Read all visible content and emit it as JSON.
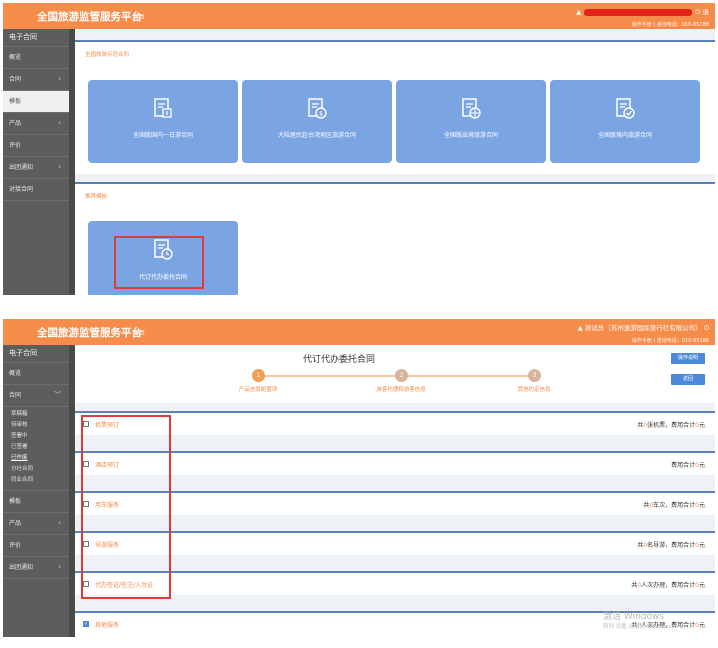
{
  "shot1": {
    "brand": "全国旅游监管服务平台",
    "home": "首页",
    "user_tail": "退",
    "user_sub": "操作手册 | 咨询电话：010-65788",
    "sidebar": [
      {
        "label": "电子合同",
        "type": "header"
      },
      {
        "label": "概览",
        "chev": ""
      },
      {
        "label": "合同",
        "chev": "‹"
      },
      {
        "label": "模板",
        "chev": "",
        "active": true
      },
      {
        "label": "产品",
        "chev": "‹"
      },
      {
        "label": "评价",
        "chev": ""
      },
      {
        "label": "出团通知",
        "chev": "‹"
      },
      {
        "label": "对接合同",
        "chev": ""
      }
    ],
    "panel1_title": "全国旅游示范合同",
    "cards": [
      {
        "label": "全国版国内一日游合同"
      },
      {
        "label": "大陆居民赴台湾地区旅游合同"
      },
      {
        "label": "全国版出境旅游合同"
      },
      {
        "label": "全国版境内旅游合同"
      }
    ],
    "panel2_title": "推荐模板",
    "recommend_card": "代订代办委托合同"
  },
  "shot2": {
    "brand": "全国旅游监管服务平台",
    "home": "首页",
    "user": "测试员（苏州速游国际旅行社有限公司）",
    "user_sub": "操作手册 | 咨询电话：010-65188",
    "sidebar_header": "电子合同",
    "sidebar_top": [
      {
        "label": "概览",
        "chev": ""
      },
      {
        "label": "合同",
        "chev": "﹀"
      }
    ],
    "sidebar_sub": [
      "草稿箱",
      "待审核",
      "签署中",
      "已签署",
      "已作废",
      "分社合同",
      "同业合同"
    ],
    "sidebar_sub_current": 4,
    "sidebar_bottom": [
      {
        "label": "模板",
        "chev": ""
      },
      {
        "label": "产品",
        "chev": "‹"
      },
      {
        "label": "评价",
        "chev": ""
      },
      {
        "label": "出团通知",
        "chev": "‹"
      }
    ],
    "page_title": "代订代办委托合同",
    "btn_guide": "操作说明",
    "btn_back": "返回",
    "steps": [
      {
        "num": "1",
        "label": "产品信息配置项"
      },
      {
        "num": "2",
        "label": "游客代理和游客信息"
      },
      {
        "num": "3",
        "label": "其他约定信息"
      }
    ],
    "items": [
      {
        "name": "机票预订",
        "summary_pre": "共",
        "count": "0",
        "summary_mid": "张机票，费用合计",
        "fee": "0",
        "unit": "元",
        "checked": false
      },
      {
        "name": "酒店预订",
        "summary_pre": "",
        "count": "",
        "summary_mid": "费用合计",
        "fee": "0",
        "unit": "元",
        "checked": false
      },
      {
        "name": "用车服务",
        "summary_pre": "共",
        "count": "0",
        "summary_mid": "车次，费用合计",
        "fee": "0",
        "unit": "元",
        "checked": false
      },
      {
        "name": "导游服务",
        "summary_pre": "共",
        "count": "0",
        "summary_mid": "名导游，费用合计",
        "fee": "0",
        "unit": "元",
        "checked": false
      },
      {
        "name": "代办签证/签注/入台证",
        "summary_pre": "共",
        "count": "0",
        "summary_mid": "人次办理，费用合计",
        "fee": "0",
        "unit": "元",
        "checked": false
      },
      {
        "name": "其他服务",
        "summary_pre": "共",
        "count": "0",
        "summary_mid": "人次办理，费用合计",
        "fee": "0",
        "unit": "元",
        "checked": true
      }
    ],
    "watermark": "激活 Windows",
    "watermark_sub": "转到 设置 以激活 Windows。"
  },
  "colors": {
    "topbar": "#f58c4a",
    "card": "#7ba4e3",
    "sidebar": "#5d5d5d",
    "highlight": "#e03a3a",
    "accent": "#f58c4a"
  }
}
